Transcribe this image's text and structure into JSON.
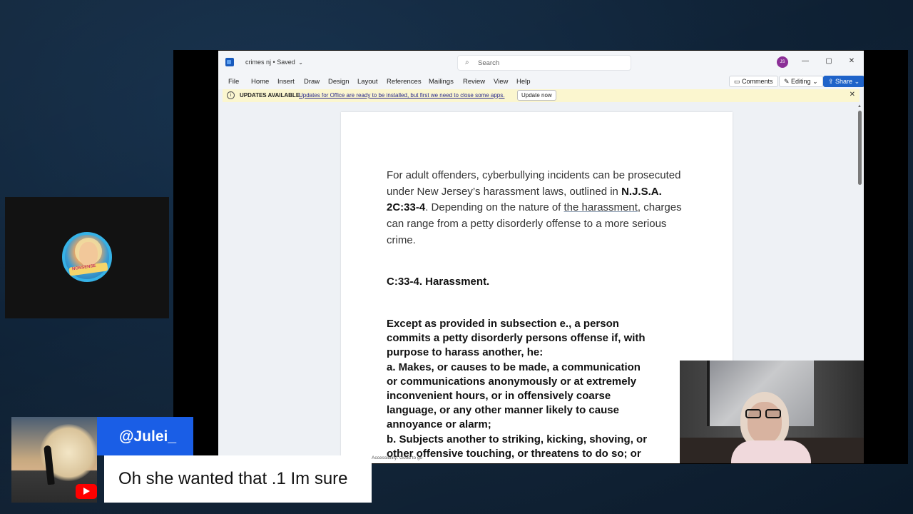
{
  "word": {
    "title": "crimes nj",
    "saved_label": "Saved",
    "search_placeholder": "Search",
    "avatar_initials": "JS",
    "menu": [
      "File",
      "Home",
      "Insert",
      "Draw",
      "Design",
      "Layout",
      "References",
      "Mailings",
      "Review",
      "View",
      "Help"
    ],
    "comments_label": "Comments",
    "editing_label": "Editing",
    "share_label": "Share",
    "update": {
      "label": "UPDATES AVAILABLE",
      "message": "Updates for Office are ready to be installed, but first we need to close some apps.",
      "button": "Update now"
    },
    "status": "Accessibility: Good to go"
  },
  "document": {
    "para1": {
      "a": "For adult offenders, cyberbullying incidents can be prosecuted under New Jersey’s harassment laws, outlined in ",
      "bold": "N.J.S.A. 2C:33-4",
      "b": ". Depending on the nature of ",
      "underlined": "the harassment",
      "c": ", charges can range from a petty disorderly offense to a more serious crime."
    },
    "heading": "C:33-4. Harassment.",
    "statute_lines": [
      "Except as provided in subsection e., a person",
      "commits a petty disorderly persons offense if, with",
      "purpose to harass another, he:",
      "a. Makes, or causes to be made, a communication",
      "or communications anonymously or at extremely",
      "inconvenient hours, or in offensively coarse",
      "language, or any other manner likely to cause",
      "annoyance or alarm;",
      "b. Subjects another to striking, kicking, shoving, or",
      "other offensive touching, or threatens to do so; or"
    ]
  },
  "logo": {
    "text": "NONSENSE"
  },
  "chat": {
    "username": "@Julei_",
    "message": "Oh she wanted that .1 Im sure"
  },
  "colors": {
    "chat_name_bg": "#1a5ee6",
    "share_blue": "#1f63c9",
    "update_bar": "#fbf6cf",
    "youtube_red": "#ff0000"
  }
}
